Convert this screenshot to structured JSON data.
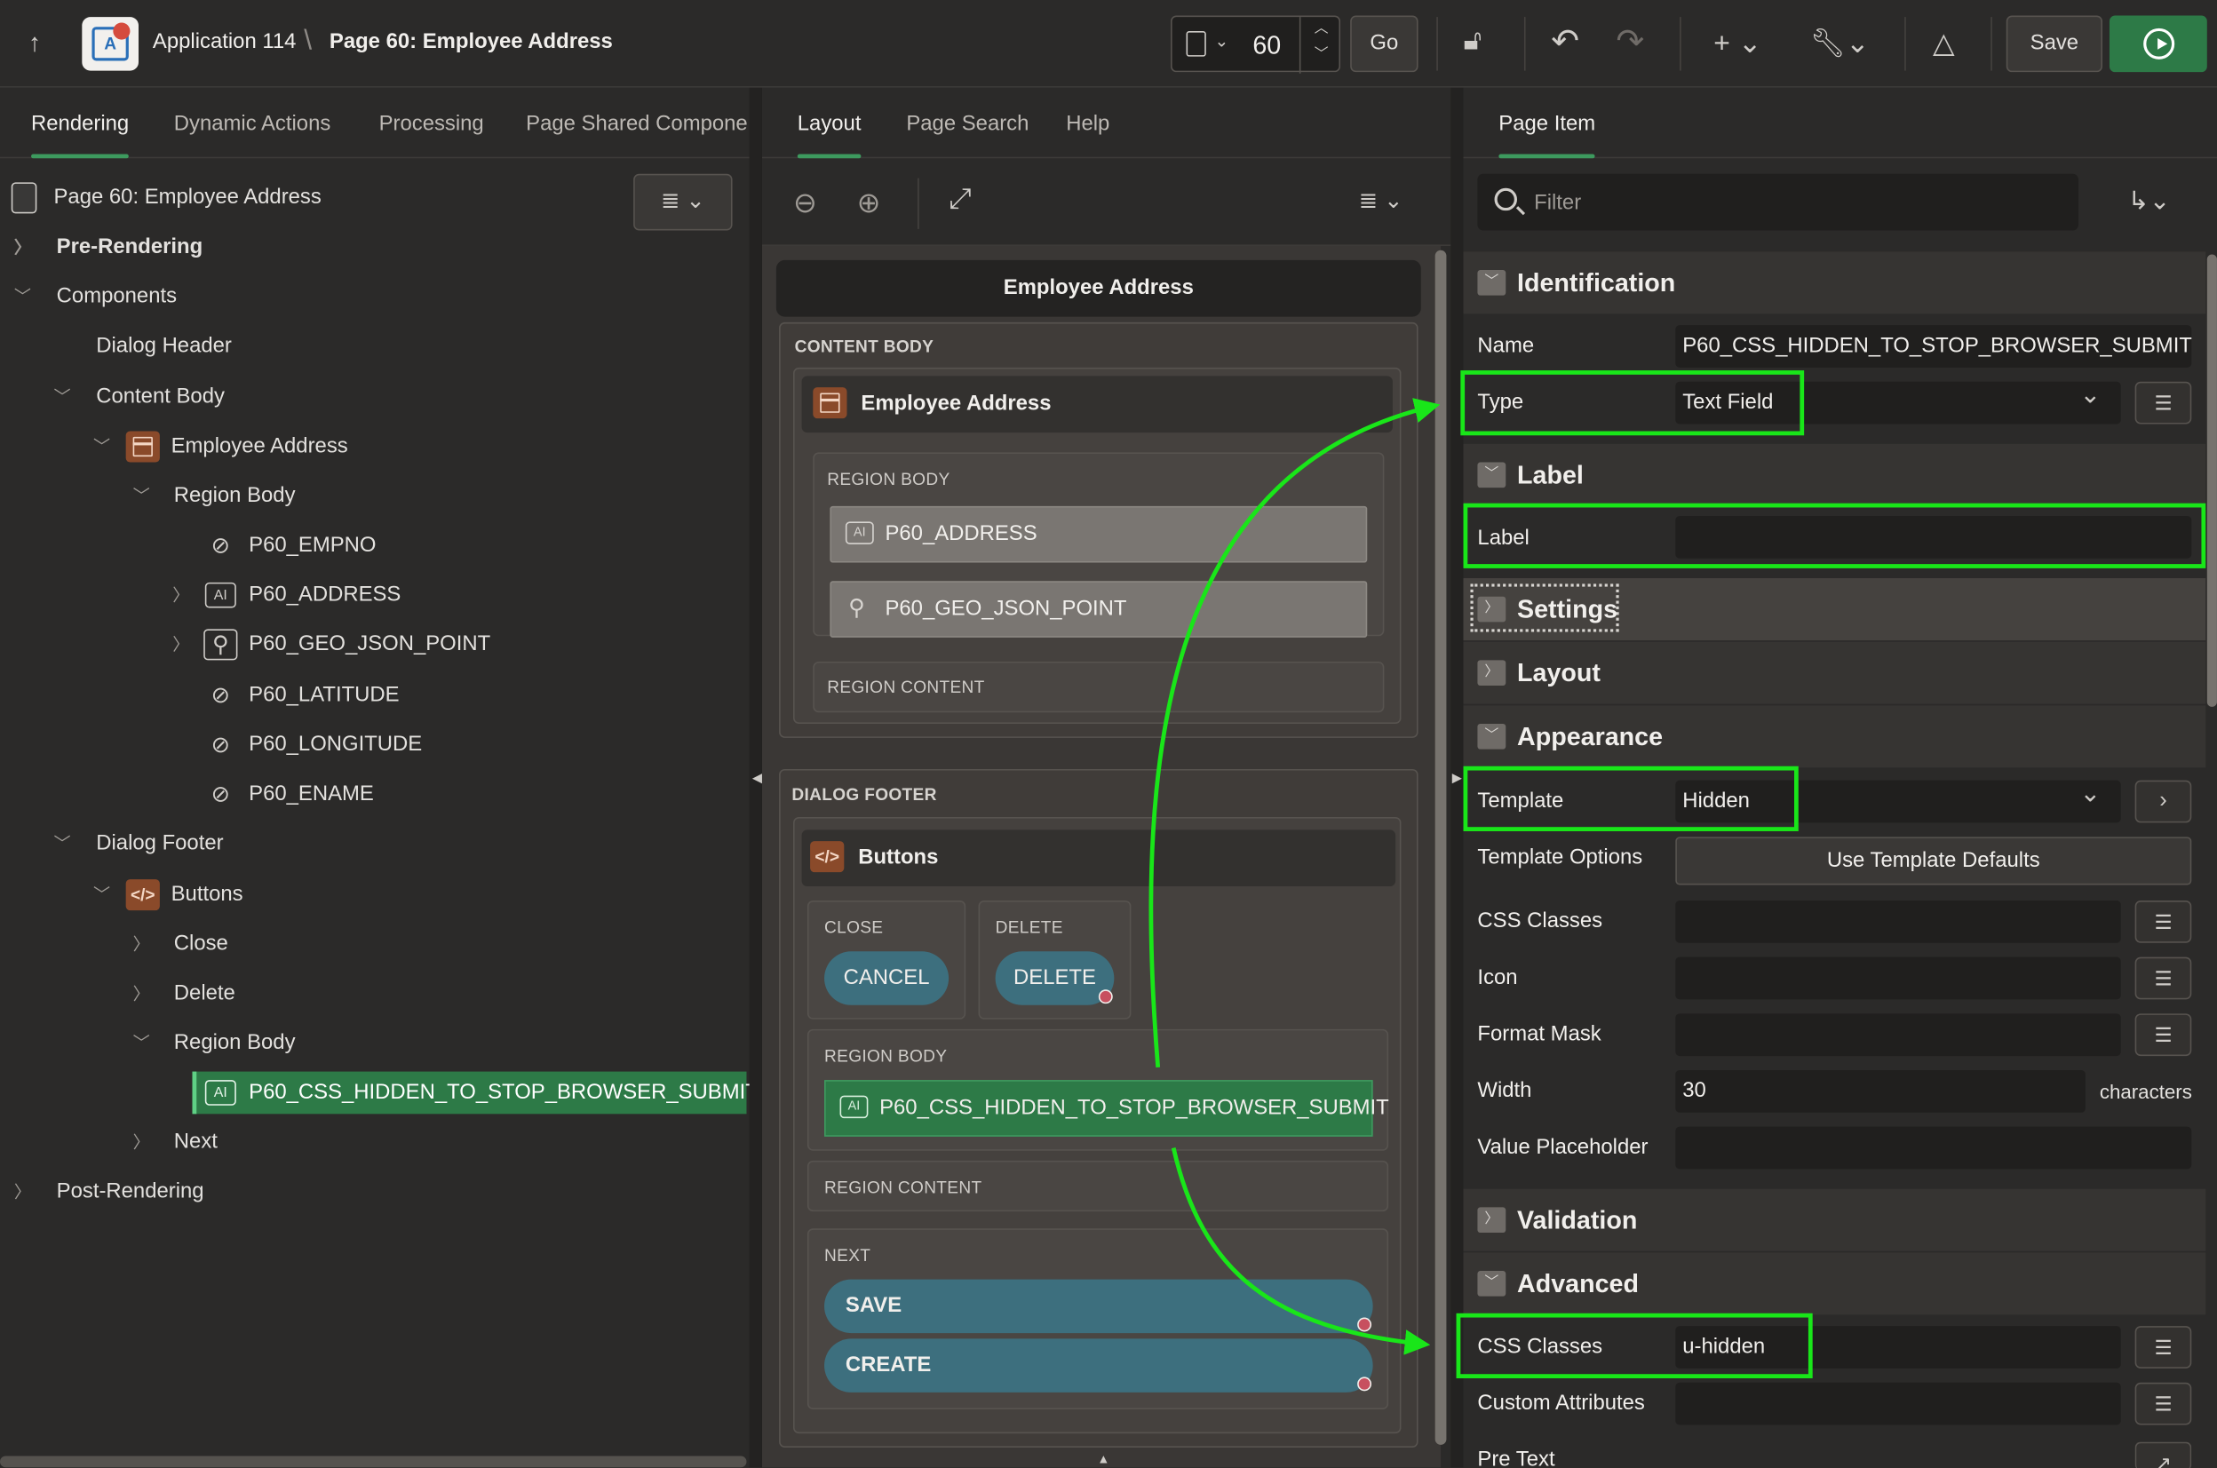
{
  "header": {
    "app_name": "Application 114",
    "separator": "\\",
    "page_title": "Page 60: Employee Address",
    "page_number": "60",
    "go_label": "Go",
    "save_label": "Save"
  },
  "left": {
    "tabs": [
      "Rendering",
      "Dynamic Actions",
      "Processing",
      "Page Shared Compone"
    ],
    "tree": {
      "root": "Page 60: Employee Address",
      "pre_rendering": "Pre-Rendering",
      "components": "Components",
      "dialog_header": "Dialog Header",
      "content_body": "Content Body",
      "employee_address": "Employee Address",
      "region_body": "Region Body",
      "items": [
        "P60_EMPNO",
        "P60_ADDRESS",
        "P60_GEO_JSON_POINT",
        "P60_LATITUDE",
        "P60_LONGITUDE",
        "P60_ENAME"
      ],
      "dialog_footer": "Dialog Footer",
      "buttons": "Buttons",
      "close": "Close",
      "delete": "Delete",
      "region_body_2": "Region Body",
      "selected_item": "P60_CSS_HIDDEN_TO_STOP_BROWSER_SUBMIT",
      "next": "Next",
      "post_rendering": "Post-Rendering"
    }
  },
  "middle": {
    "tabs": [
      "Layout",
      "Page Search",
      "Help"
    ],
    "dialog_title": "Employee Address",
    "content_body_label": "CONTENT BODY",
    "region_title": "Employee Address",
    "region_body_label": "REGION BODY",
    "item_address": "P60_ADDRESS",
    "item_geo": "P60_GEO_JSON_POINT",
    "region_content_label": "REGION CONTENT",
    "dialog_footer_label": "DIALOG FOOTER",
    "buttons_title": "Buttons",
    "close_label": "CLOSE",
    "cancel_btn": "CANCEL",
    "delete_label": "DELETE",
    "delete_btn": "DELETE",
    "region_body_label_2": "REGION BODY",
    "hidden_item": "P60_CSS_HIDDEN_TO_STOP_BROWSER_SUBMIT",
    "region_content_label_2": "REGION CONTENT",
    "next_label": "NEXT",
    "save_btn": "SAVE",
    "create_btn": "CREATE"
  },
  "right": {
    "tab": "Page Item",
    "filter_placeholder": "Filter",
    "identification": {
      "title": "Identification",
      "name_label": "Name",
      "name_value": "P60_CSS_HIDDEN_TO_STOP_BROWSER_SUBMIT",
      "type_label": "Type",
      "type_value": "Text Field"
    },
    "label_group": {
      "title": "Label",
      "label_label": "Label",
      "label_value": ""
    },
    "settings_title": "Settings",
    "layout_title": "Layout",
    "appearance": {
      "title": "Appearance",
      "template_label": "Template",
      "template_value": "Hidden",
      "template_options_label": "Template Options",
      "template_options_btn": "Use Template Defaults",
      "css_classes_label": "CSS Classes",
      "icon_label": "Icon",
      "format_mask_label": "Format Mask",
      "width_label": "Width",
      "width_value": "30",
      "width_unit": "characters",
      "placeholder_label": "Value Placeholder"
    },
    "validation_title": "Validation",
    "advanced": {
      "title": "Advanced",
      "css_classes_label": "CSS Classes",
      "css_classes_value": "u-hidden",
      "custom_attr_label": "Custom Attributes",
      "pre_text_label": "Pre Text"
    }
  },
  "colors": {
    "accent_green": "#2d7a47",
    "highlight": "#19e619",
    "button_teal": "#3d6f7e"
  }
}
